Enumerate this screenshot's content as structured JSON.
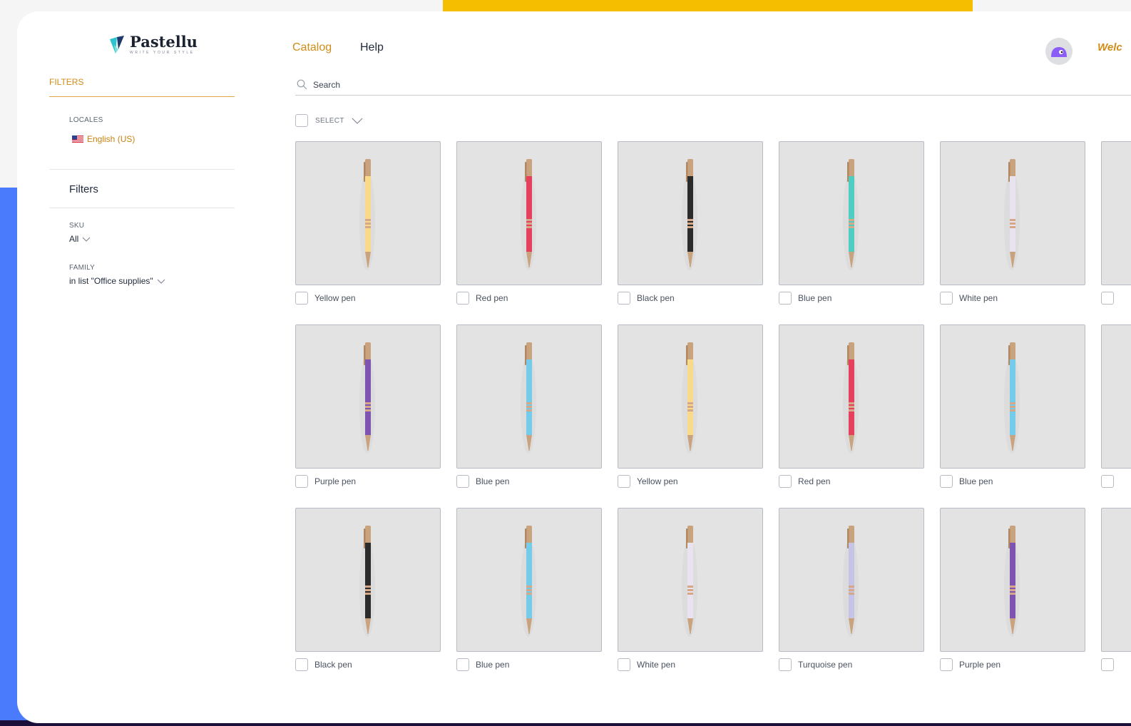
{
  "app": {
    "name": "Pastellu",
    "tagline": "WRITE YOUR STYLE"
  },
  "nav": {
    "catalog": "Catalog",
    "help": "Help",
    "welcome": "Welc"
  },
  "sidebar": {
    "filters_tab": "FILTERS",
    "locales_label": "LOCALES",
    "locale_value": "English (US)",
    "filters_heading": "Filters",
    "sku_label": "SKU",
    "sku_value": "All",
    "family_label": "FAMILY",
    "family_value": "in list \"Office supplies\""
  },
  "search": {
    "placeholder": "Search"
  },
  "select": {
    "label": "SELECT"
  },
  "colors": {
    "accent": "#d08c17",
    "yellow": "#f9d98a",
    "red": "#e5405e",
    "black": "#2b2b2b",
    "turquoise": "#4fcdc2",
    "white": "#e9e2ef",
    "purple": "#7d55b0",
    "blue": "#74cbea",
    "lavender": "#c5c4e6"
  },
  "products": [
    {
      "label": "Yellow pen",
      "color": "yellow"
    },
    {
      "label": "Red pen",
      "color": "red"
    },
    {
      "label": "Black pen",
      "color": "black"
    },
    {
      "label": "Blue pen",
      "color": "turquoise"
    },
    {
      "label": "White pen",
      "color": "white"
    },
    {
      "label": "",
      "color": ""
    },
    {
      "label": "Purple pen",
      "color": "purple"
    },
    {
      "label": "Blue pen",
      "color": "blue"
    },
    {
      "label": "Yellow pen",
      "color": "yellow"
    },
    {
      "label": "Red pen",
      "color": "red"
    },
    {
      "label": "Blue pen",
      "color": "blue"
    },
    {
      "label": "",
      "color": ""
    },
    {
      "label": "Black pen",
      "color": "black"
    },
    {
      "label": "Blue pen",
      "color": "blue"
    },
    {
      "label": "White pen",
      "color": "white"
    },
    {
      "label": "Turquoise pen",
      "color": "lavender"
    },
    {
      "label": "Purple pen",
      "color": "purple"
    },
    {
      "label": "",
      "color": ""
    }
  ]
}
